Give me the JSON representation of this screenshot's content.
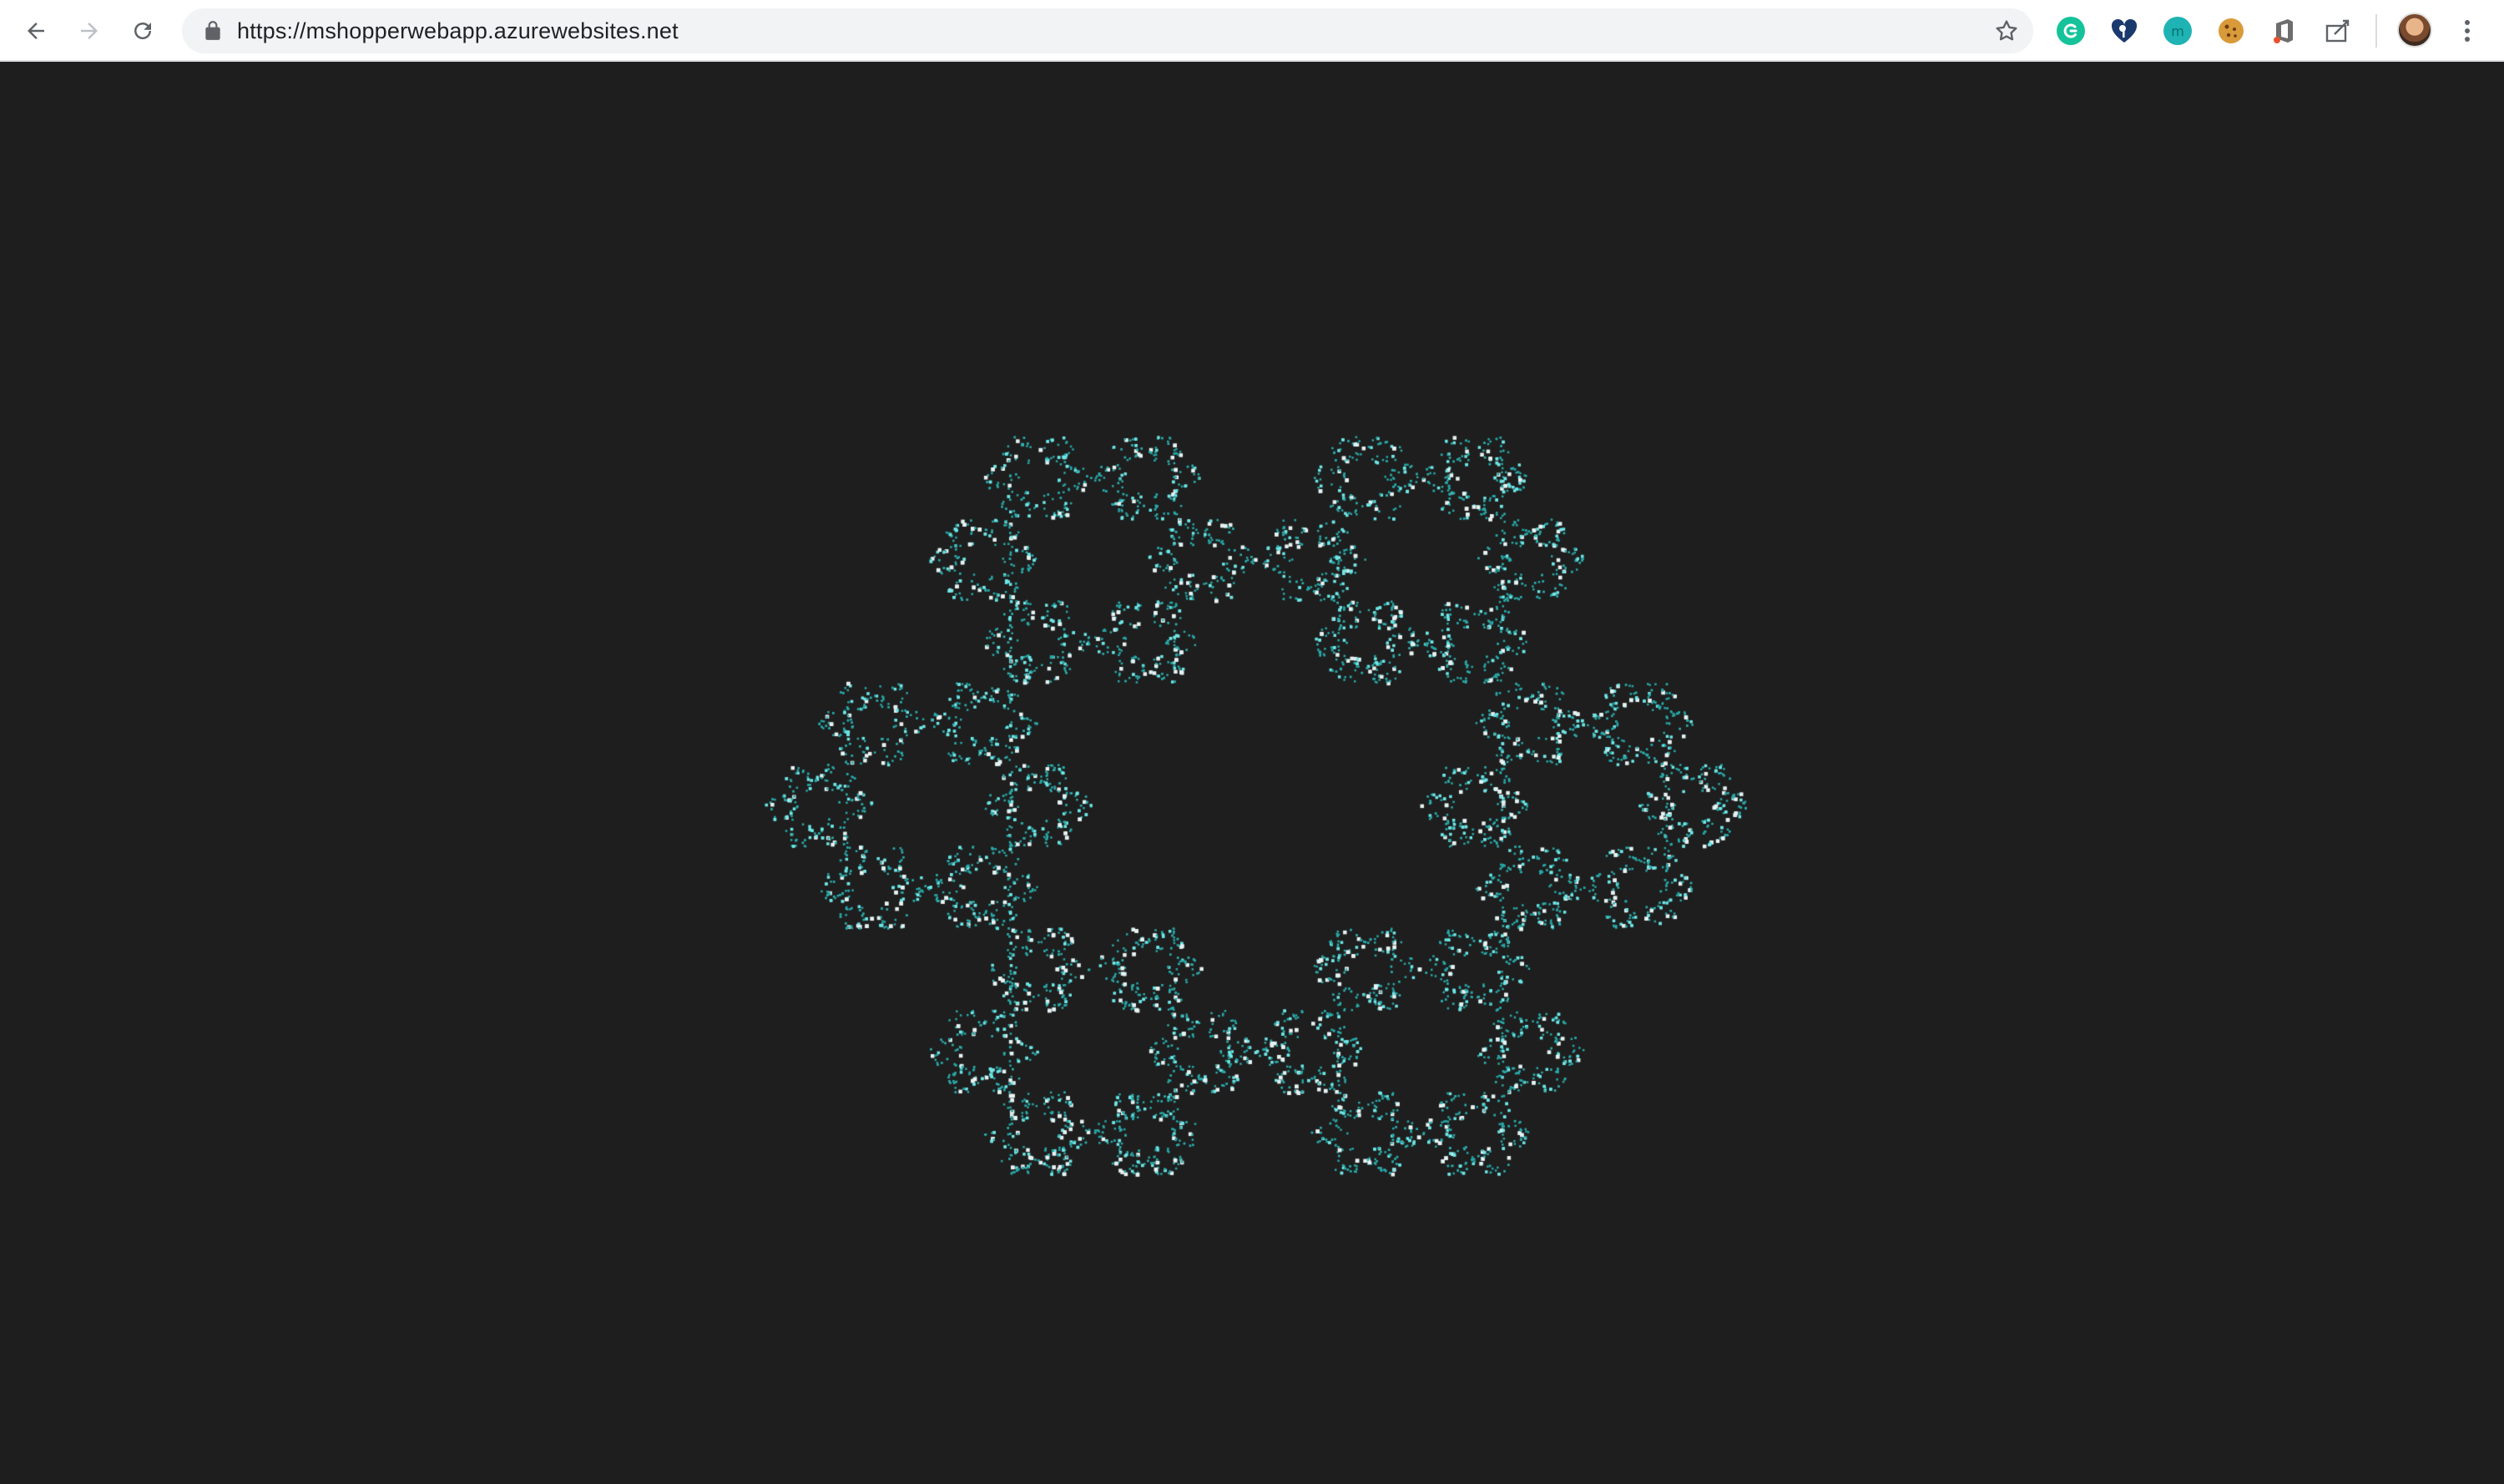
{
  "browser": {
    "url": "https://mshopperwebapp.azurewebsites.net",
    "icons": {
      "back": "arrow-back-icon",
      "forward": "arrow-forward-icon",
      "reload": "reload-icon",
      "lock": "lock-icon",
      "bookmark": "star-icon",
      "menu": "vertical-dots-icon"
    },
    "extensions": [
      "grammarly-icon",
      "heart-key-icon",
      "mercury-icon",
      "cookie-icon",
      "office-icon",
      "clip-icon"
    ]
  },
  "colors": {
    "page_background": "#1e1e1e",
    "dot_teal": "#2aa8a8",
    "dot_bright": "#6fe6e6",
    "dot_white": "#e6f2f2"
  },
  "fractal": {
    "description_icon": "hexagonal-chaos-game-fractal"
  }
}
